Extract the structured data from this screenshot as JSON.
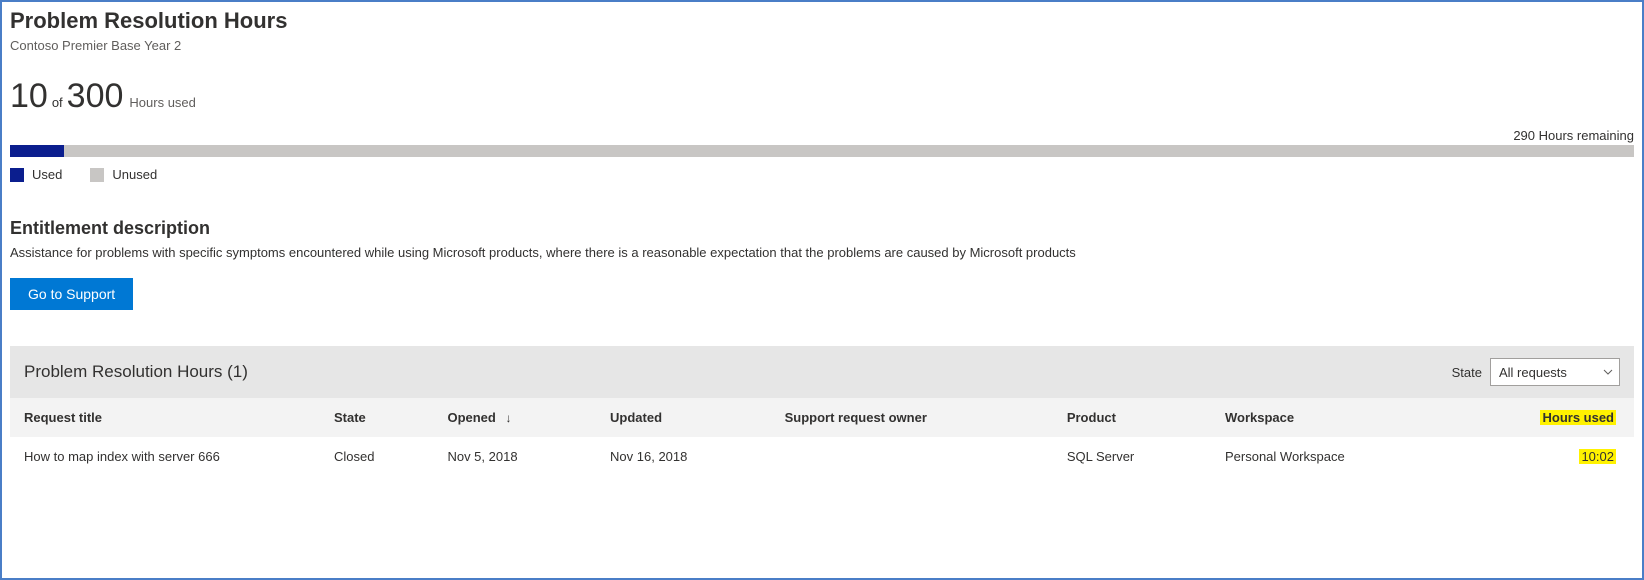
{
  "header": {
    "title": "Problem Resolution Hours",
    "subtitle": "Contoso Premier Base Year 2"
  },
  "usage": {
    "used": "10",
    "of_label": "of",
    "total": "300",
    "hours_used_label": "Hours used",
    "remaining_text": "290 Hours remaining",
    "progress_percent": 3.33,
    "legend_used": "Used",
    "legend_unused": "Unused"
  },
  "entitlement": {
    "heading": "Entitlement description",
    "text": "Assistance for problems with specific symptoms encountered while using Microsoft products, where there is a reasonable expectation that the problems are caused by Microsoft products",
    "button_label": "Go to Support"
  },
  "table": {
    "title": "Problem Resolution Hours (1)",
    "state_label": "State",
    "state_selected": "All requests",
    "columns": {
      "request_title": "Request title",
      "state": "State",
      "opened": "Opened",
      "updated": "Updated",
      "owner": "Support request owner",
      "product": "Product",
      "workspace": "Workspace",
      "hours_used": "Hours used"
    },
    "sort_indicator": "↓",
    "rows": [
      {
        "request_title": "How to map index with server 666",
        "state": "Closed",
        "opened": "Nov 5, 2018",
        "updated": "Nov 16, 2018",
        "owner": "",
        "product": "SQL Server",
        "workspace": "Personal Workspace",
        "hours_used": "10:02"
      }
    ]
  },
  "colors": {
    "accent": "#0078d4",
    "progress_used": "#0b1e8e",
    "progress_unused": "#c8c6c4",
    "highlight": "#fff200"
  }
}
